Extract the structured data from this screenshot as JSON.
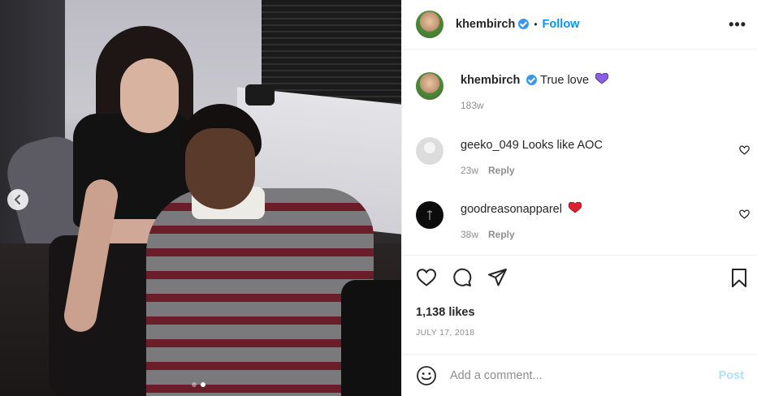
{
  "post": {
    "author": "khembirch",
    "follow_label": "Follow",
    "separator": "•",
    "more_icon": "more-horizontal-icon",
    "carousel": {
      "dots": 2,
      "active_index": 1
    }
  },
  "caption": {
    "username": "khembirch",
    "text": "True love",
    "emoji": "purple-heart",
    "age": "183w"
  },
  "comments": [
    {
      "username": "geeko_049",
      "text": "Looks like AOC",
      "age": "23w",
      "reply_label": "Reply"
    },
    {
      "username": "goodreasonapparel",
      "text": "",
      "emoji": "red-heart",
      "age": "38w",
      "reply_label": "Reply"
    }
  ],
  "actions": {
    "like_icon": "heart-icon",
    "comment_icon": "comment-icon",
    "share_icon": "send-icon",
    "save_icon": "bookmark-icon"
  },
  "likes": "1,138 likes",
  "date": "JULY 17, 2018",
  "comment_box": {
    "placeholder": "Add a comment...",
    "post_label": "Post",
    "emoji_icon": "smiley-icon"
  },
  "colors": {
    "link": "#0095f6",
    "post_disabled": "#b2dffc",
    "muted": "#8e8e8e",
    "purple_heart": "#8a5ee3",
    "red_heart": "#e0202e"
  }
}
